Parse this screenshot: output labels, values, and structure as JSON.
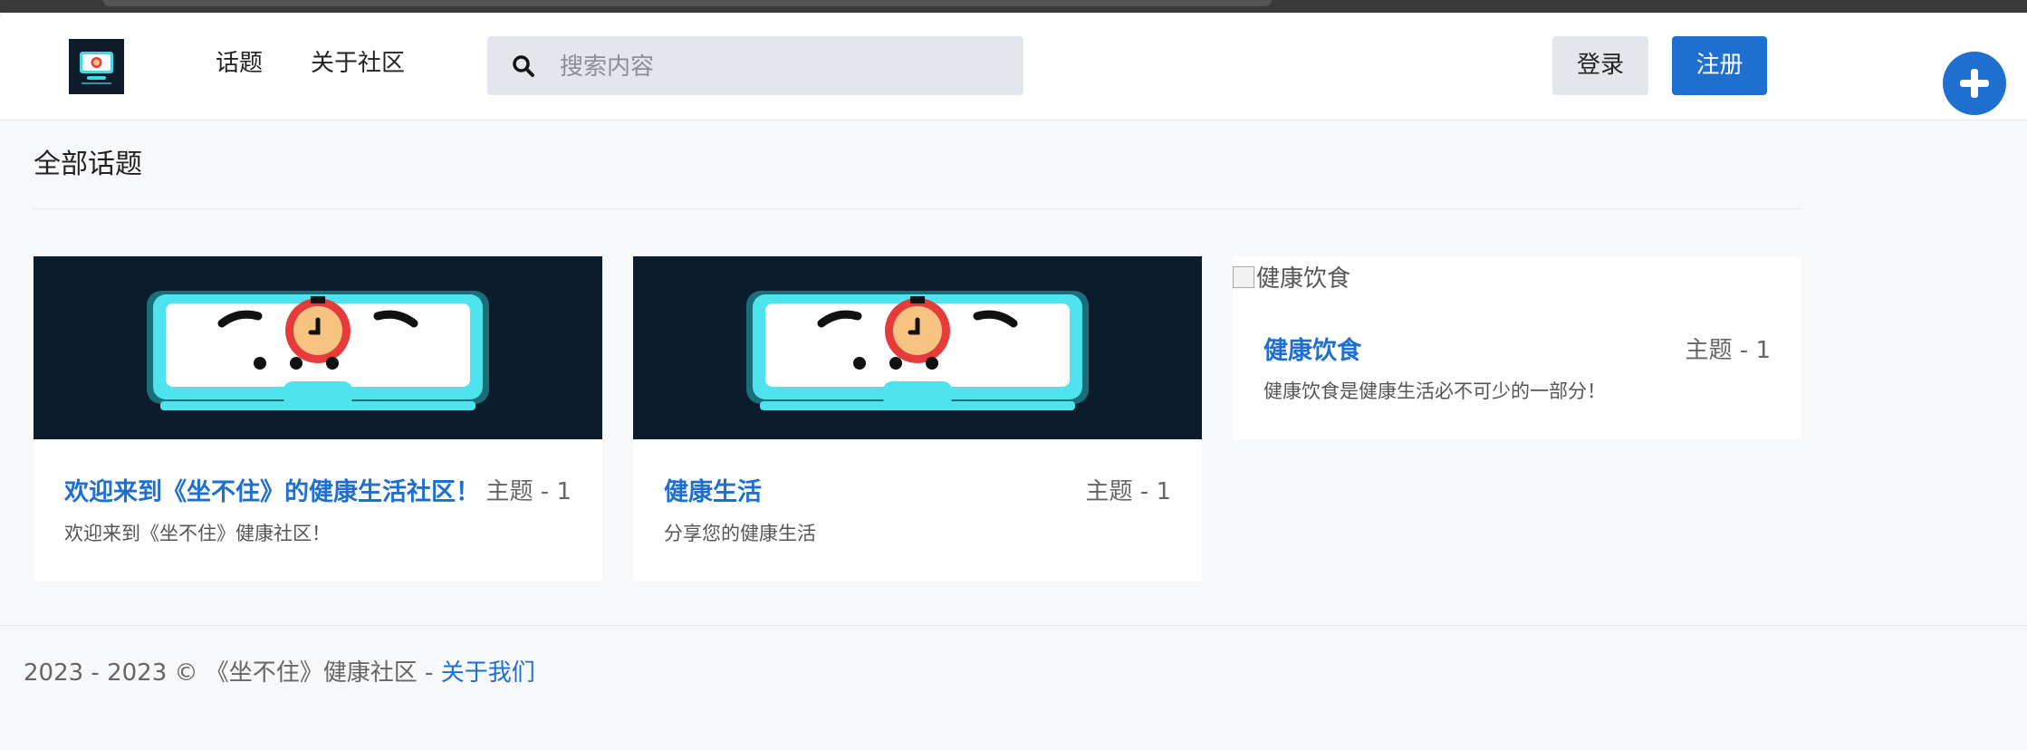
{
  "header": {
    "nav": {
      "topics": "话题",
      "about_community": "关于社区"
    },
    "search": {
      "placeholder": "搜索内容",
      "value": ""
    },
    "login_label": "登录",
    "register_label": "注册",
    "colors": {
      "primary": "#1f6fd1",
      "secondary_button": "#e3e6ea"
    },
    "icons": {
      "logo": "community-logo-icon",
      "search": "search-icon",
      "add": "plus-icon"
    }
  },
  "main": {
    "title": "全部话题",
    "categories": [
      {
        "name": "欢迎来到《坐不住》的健康生活社区！",
        "count_label": "主题 - 1",
        "description": "欢迎来到《坐不住》健康社区！",
        "image": "sedentary-timer-illustration"
      },
      {
        "name": "健康生活",
        "count_label": "主题 - 1",
        "description": "分享您的健康生活",
        "image": "sedentary-timer-illustration"
      },
      {
        "name": "健康饮食",
        "count_label": "主题 - 1",
        "description": "健康饮食是健康生活必不可少的一部分！",
        "image_alt": "健康饮食"
      }
    ]
  },
  "footer": {
    "copyright": "2023 - 2023 © 《坐不住》健康社区 - ",
    "about_us": "关于我们"
  }
}
